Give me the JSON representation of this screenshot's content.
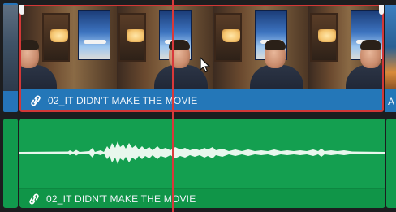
{
  "timeline": {
    "video_track": {
      "clip": {
        "name": "02_IT DIDN'T MAKE THE MOVIE",
        "link_icon": "link-icon",
        "selected": true,
        "color": "#2477b8",
        "selection_color": "#d23737"
      },
      "next_clip": {
        "label_partial": "A"
      }
    },
    "audio_track": {
      "clip": {
        "name": "02_IT DIDN'T MAKE THE MOVIE",
        "link_icon": "link-icon",
        "color": "#139d4f"
      }
    },
    "playhead": {
      "color": "#d9383a"
    },
    "pointer": {
      "icon": "arrow-cursor-icon"
    }
  }
}
